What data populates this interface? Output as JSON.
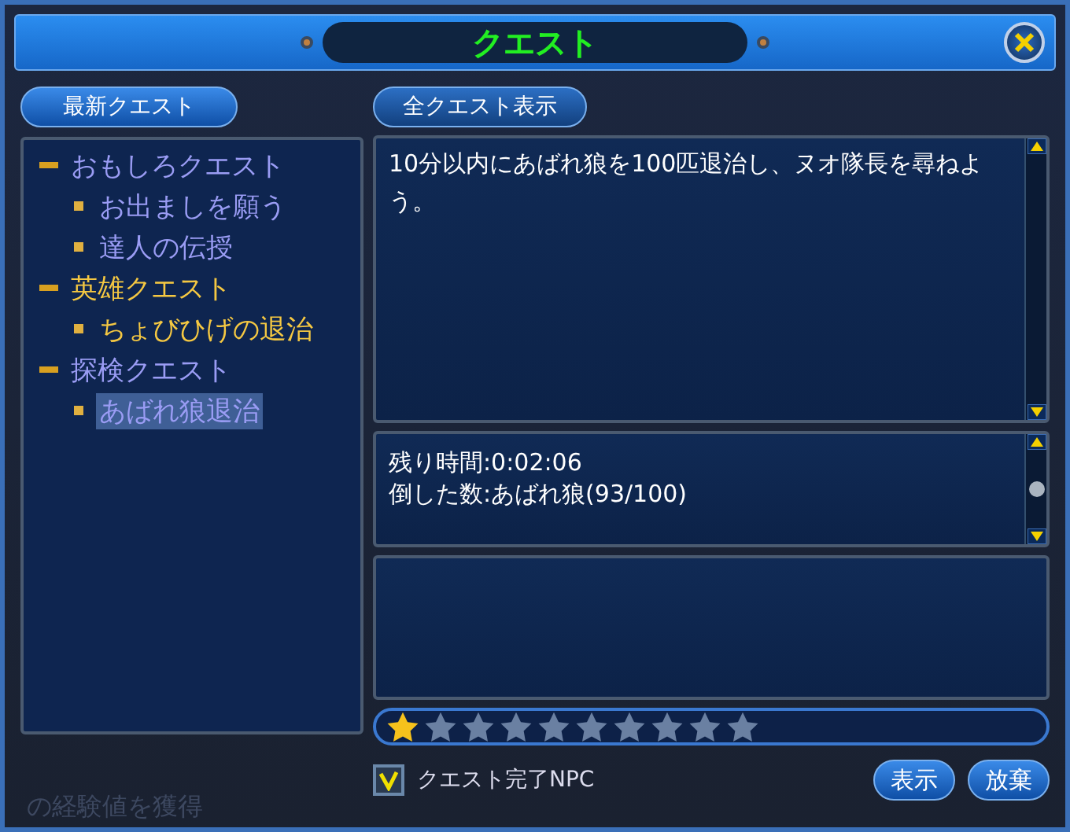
{
  "window": {
    "title": "クエスト"
  },
  "tabs": [
    {
      "label": "最新クエスト",
      "selected": true
    },
    {
      "label": "全クエスト表示",
      "selected": false
    }
  ],
  "quest_tree": [
    {
      "label": "おもしろクエスト",
      "expanded": true,
      "color": "#9a9cf4",
      "children": [
        {
          "label": "お出ましを願う",
          "selected": false
        },
        {
          "label": "達人の伝授",
          "selected": false
        }
      ]
    },
    {
      "label": "英雄クエスト",
      "expanded": true,
      "color": "#f5c842",
      "children": [
        {
          "label": "ちょびひげの退治",
          "selected": false
        }
      ]
    },
    {
      "label": "探検クエスト",
      "expanded": true,
      "color": "#9a9cf4",
      "children": [
        {
          "label": "あばれ狼退治",
          "selected": true
        }
      ]
    }
  ],
  "description": "10分以内にあばれ狼を100匹退治し、ヌオ隊長を尋ねよう。",
  "progress": [
    "残り時間:0:02:06",
    "倒した数:あばれ狼(93/100)"
  ],
  "difficulty": {
    "stars": 1
  },
  "complete_npc": {
    "label": "クエスト完了NPC",
    "checked": true
  },
  "buttons": [
    "表示",
    "放棄"
  ],
  "background_text": "の経験値を獲得"
}
